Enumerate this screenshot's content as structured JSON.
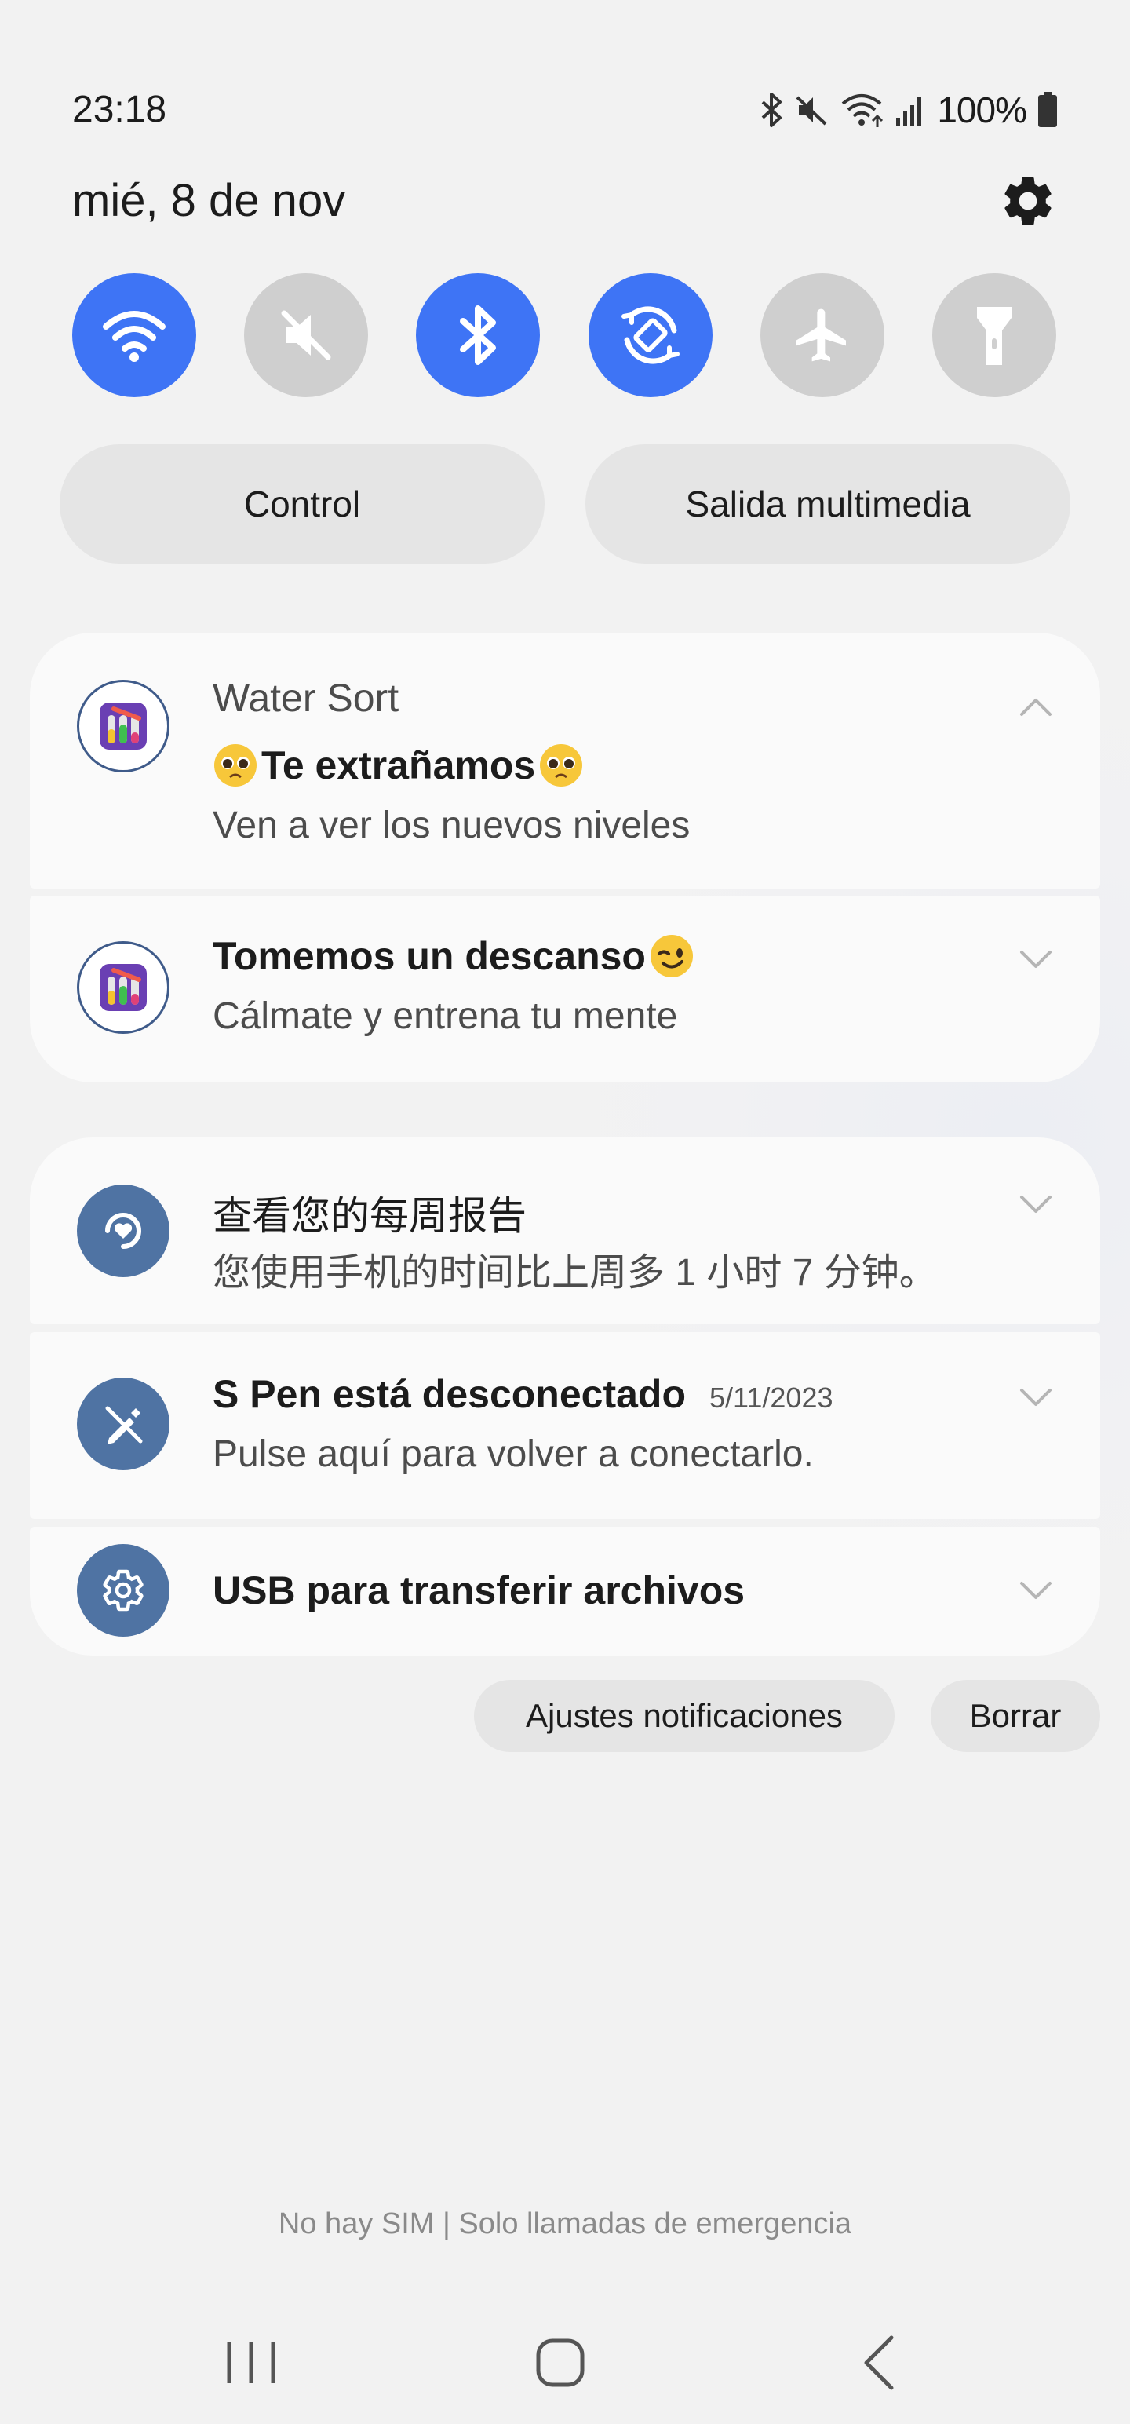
{
  "status_bar": {
    "time": "23:18",
    "battery": "100%",
    "icons": [
      "bluetooth-icon",
      "mute-icon",
      "wifi-icon",
      "signal-icon",
      "battery-icon"
    ]
  },
  "header": {
    "date": "mié, 8 de nov",
    "settings_icon": "gear-icon"
  },
  "quick_toggles": [
    {
      "icon": "wifi-icon",
      "state": "on"
    },
    {
      "icon": "mute-icon",
      "state": "off"
    },
    {
      "icon": "bluetooth-icon",
      "state": "on"
    },
    {
      "icon": "auto-rotate-icon",
      "state": "on"
    },
    {
      "icon": "airplane-icon",
      "state": "off"
    },
    {
      "icon": "flashlight-icon",
      "state": "off"
    }
  ],
  "panel_buttons": {
    "control": "Control",
    "media_output": "Salida multimedia"
  },
  "notification_groups": [
    {
      "app": "Water Sort",
      "items": [
        {
          "title": "Te extrañamos",
          "text": "Ven a ver los nuevos niveles"
        },
        {
          "title": "Tomemos un descanso",
          "text": "Cálmate y entrena tu mente"
        }
      ]
    },
    {
      "items": [
        {
          "title": "查看您的每周报告",
          "text": "您使用手机的时间比上周多 1 小时 7 分钟。"
        },
        {
          "title": "S Pen está desconectado",
          "date": "5/11/2023",
          "text": "Pulse aquí para volver a conectarlo."
        },
        {
          "title": "USB para transferir archivos"
        }
      ]
    }
  ],
  "actions": {
    "notification_settings": "Ajustes notificaciones",
    "clear": "Borrar"
  },
  "footer": {
    "sim_status": "No hay SIM | Solo llamadas de emergencia"
  },
  "colors": {
    "toggle_on": "#3e74f5",
    "toggle_off": "#cfcfcf",
    "card_bg": "#fafafa",
    "app_icon_blue": "#4f73a3"
  }
}
